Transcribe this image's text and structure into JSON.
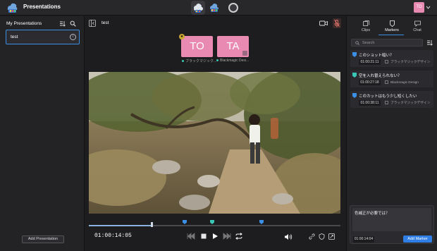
{
  "app": {
    "title": "Presentations"
  },
  "user": {
    "initials": "TO"
  },
  "sidebar": {
    "heading": "My Presentations",
    "presentations": [
      {
        "name": "test"
      }
    ],
    "add_button": "Add Presentation"
  },
  "main": {
    "title": "test",
    "participants": [
      {
        "initials": "TO",
        "name": "ブラックマジック...",
        "host": true
      },
      {
        "initials": "TA",
        "name": "Blackmagic Desi...",
        "host": false
      }
    ],
    "timecode": "01:00:14:05",
    "progress_fraction": 0.25,
    "timeline_markers": [
      0.38,
      0.49,
      0.685
    ]
  },
  "right_panel": {
    "tabs": [
      {
        "label": "Clips"
      },
      {
        "label": "Markers"
      },
      {
        "label": "Chat"
      }
    ],
    "active_tab": "Markers",
    "search_placeholder": "Search",
    "markers": [
      {
        "text": "このショット暗い？",
        "timecode": "01:00:21:11",
        "author": "ブラックマジックデザイン",
        "color": "#3c8fe6"
      },
      {
        "text": "空を入れ替えられない？",
        "timecode": "01:00:27:18",
        "author": "Blackmagic Design",
        "color": "#3ac7b5"
      },
      {
        "text": "このカットはもう少し短くしたい",
        "timecode": "01:00:38:11",
        "author": "ブラックマジックデザイン",
        "color": "#3c8fe6"
      }
    ],
    "composer": {
      "text": "色補正が必要では？",
      "timecode": "01:00:14:04",
      "submit_label": "Add Marker"
    }
  },
  "colors": {
    "accent": "#3c8fe6",
    "avatar": "#e88ab1",
    "teal": "#3ac7b5"
  }
}
